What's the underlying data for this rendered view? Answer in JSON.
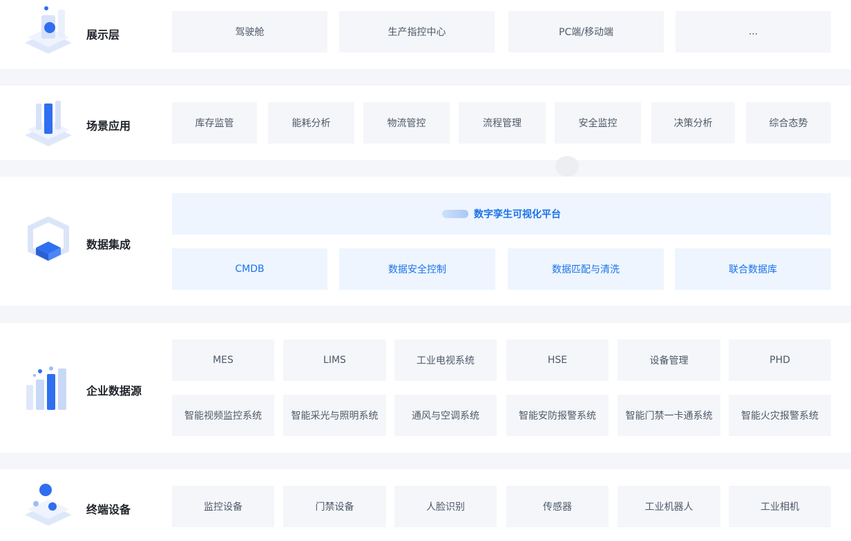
{
  "rows": [
    {
      "label": "展示层",
      "icon": "display-layer-icon",
      "items": [
        "驾驶舱",
        "生产指控中心",
        "PC端/移动端",
        "..."
      ]
    },
    {
      "label": "场景应用",
      "icon": "scene-application-icon",
      "items": [
        "库存监管",
        "能耗分析",
        "物流管控",
        "流程管理",
        "安全监控",
        "决策分析",
        "综合态势"
      ]
    },
    {
      "label": "数据集成",
      "icon": "data-integration-icon",
      "platform": "数字孪生可视化平台",
      "items": [
        "CMDB",
        "数据安全控制",
        "数据匹配与清洗",
        "联合数据库"
      ]
    },
    {
      "label": "企业数据源",
      "icon": "enterprise-data-source-icon",
      "items_row1": [
        "MES",
        "LIMS",
        "工业电视系统",
        "HSE",
        "设备管理",
        "PHD"
      ],
      "items_row2": [
        "智能视频监控系统",
        "智能采光与照明系统",
        "通风与空调系统",
        "智能安防报警系统",
        "智能门禁一卡通系统",
        "智能火灾报警系统"
      ]
    },
    {
      "label": "终端设备",
      "icon": "terminal-device-icon",
      "items": [
        "监控设备",
        "门禁设备",
        "人脸识别",
        "传感器",
        "工业机器人",
        "工业相机"
      ]
    }
  ],
  "colors": {
    "accent": "#1a73e8",
    "tile_bg": "#f4f6f9",
    "tile_blue_bg": "#eef5ff",
    "text": "#4e5969"
  }
}
